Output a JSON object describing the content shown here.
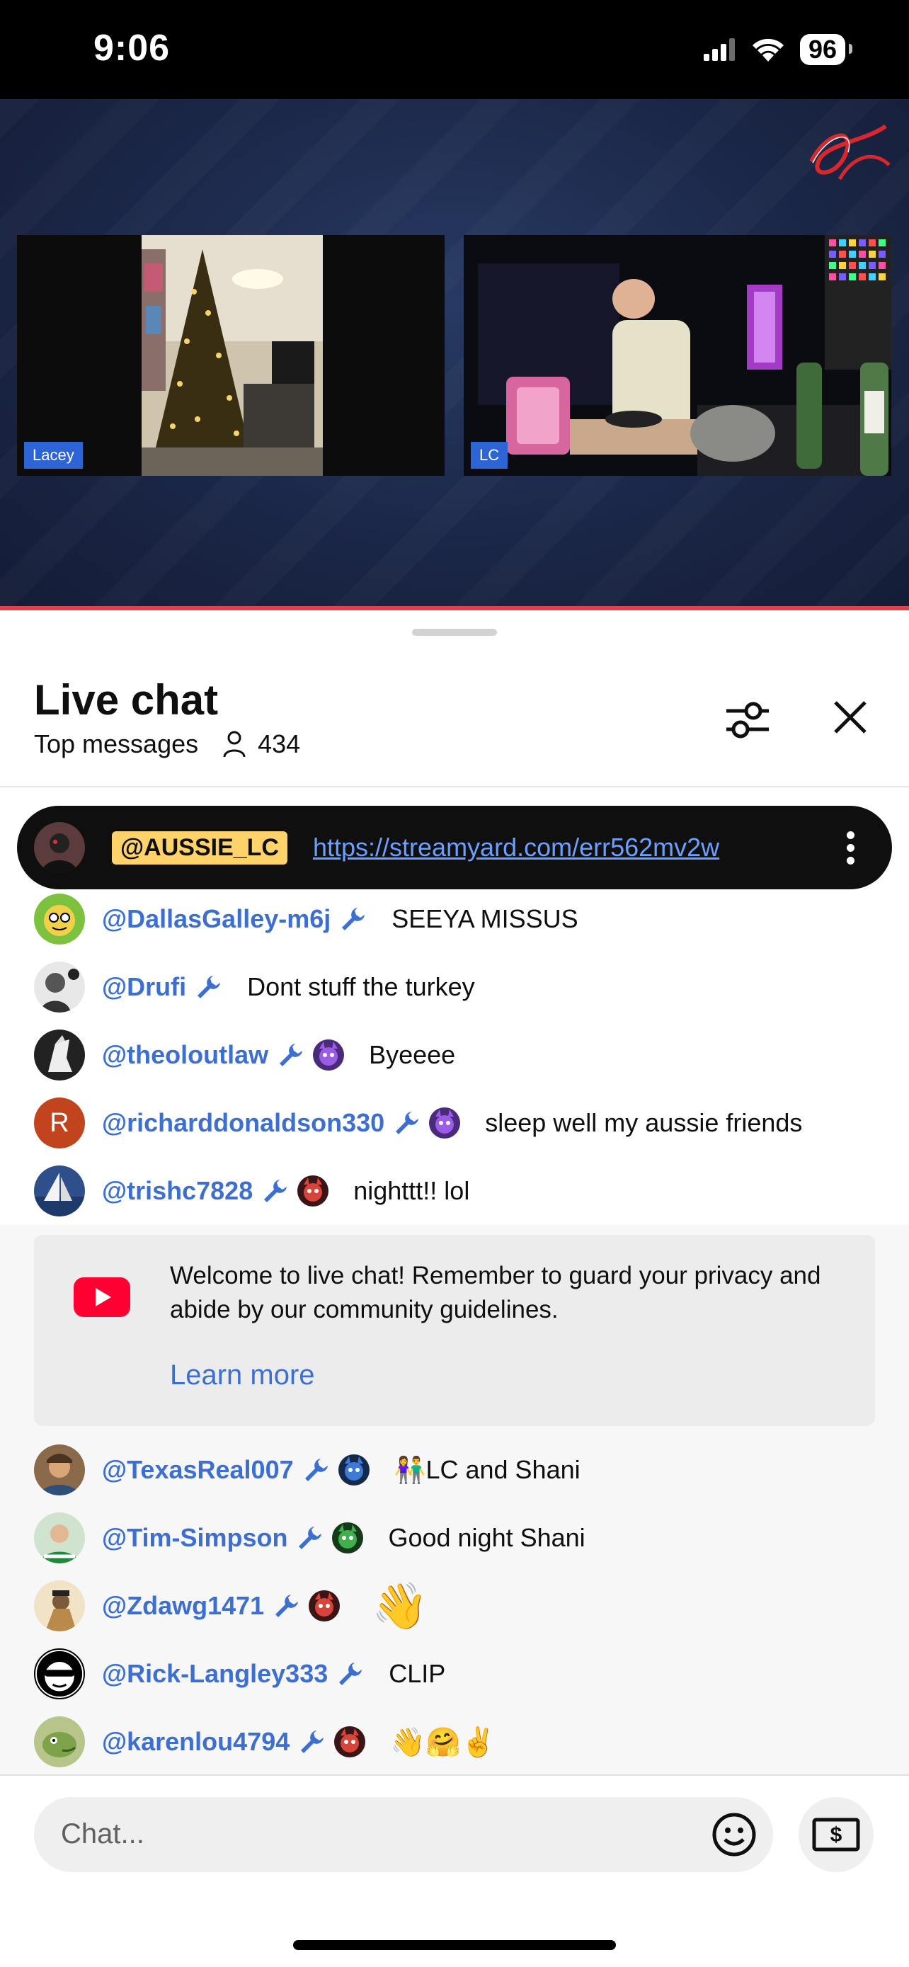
{
  "status": {
    "time": "9:06",
    "battery": "96"
  },
  "stream": {
    "tiles": [
      {
        "name": "Lacey"
      },
      {
        "name": "LC"
      }
    ]
  },
  "chat": {
    "title": "Live chat",
    "mode": "Top messages",
    "viewer_count": "434",
    "pinned": {
      "author": "@AUSSIE_LC",
      "link": "https://streamyard.com/err562mv2w"
    },
    "messages_top": [
      {
        "author": "@DallasGalley-m6j",
        "text": "SEEYA MISSUS",
        "badge": false
      },
      {
        "author": "@Drufi",
        "text": "Dont stuff the turkey",
        "badge": false
      },
      {
        "author": "@theoloutlaw",
        "text": "Byeeee",
        "badge": true
      },
      {
        "author": "@richarddonaldson330",
        "text": "sleep well my aussie friends",
        "badge": true,
        "initial": "R"
      },
      {
        "author": "@trishc7828",
        "text": "nighttt!! lol",
        "badge": true
      }
    ],
    "welcome": {
      "text": "Welcome to live chat! Remember to guard your privacy and abide by our community guidelines.",
      "link": "Learn more"
    },
    "messages_bottom": [
      {
        "author": "@TexasReal007",
        "text": "👫LC and Shani",
        "badge": true
      },
      {
        "author": "@Tim-Simpson",
        "text": "Good night Shani",
        "badge": true
      },
      {
        "author": "@Zdawg1471",
        "text": "👋",
        "badge": true
      },
      {
        "author": "@Rick-Langley333",
        "text": "CLIP",
        "badge": false
      },
      {
        "author": "@karenlou4794",
        "text": "👋🤗✌️",
        "badge": true
      }
    ],
    "input_placeholder": "Chat..."
  },
  "colors": {
    "author_link": "#3d6fd1",
    "owner_badge": "#ffd36a",
    "youtube_red": "#ff0033",
    "progress": "#e43f4b"
  },
  "icons": [
    "signal-icon",
    "wifi-icon",
    "battery-icon",
    "person-icon",
    "filter-icon",
    "close-icon",
    "kebab-icon",
    "wrench-icon",
    "member-badge-icon",
    "youtube-icon",
    "emoji-icon",
    "super-chat-icon"
  ]
}
